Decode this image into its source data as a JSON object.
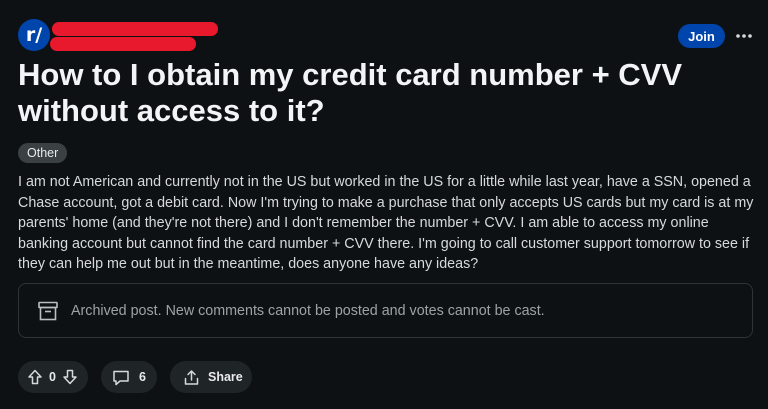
{
  "post": {
    "subreddit_avatar": "r/",
    "join_label": "Join",
    "more_label": "•••",
    "title": "How to I obtain my credit card number + CVV without access to it?",
    "flair": "Other",
    "body": "I am not American and currently not in the US but worked in the US for a little while last year, have a SSN, opened a Chase account, got a debit card. Now I'm trying to make a purchase that only accepts US cards but my card is at my parents' home (and they're not there) and I don't remember the number + CVV. I am able to access my online banking account but cannot find the card number + CVV there. I'm going to call customer support tomorrow to see if they can help me out but in the meantime, does anyone have any ideas?",
    "archived_notice": "Archived post. New comments cannot be posted and votes cannot be cast."
  },
  "actions": {
    "vote_count": "0",
    "comment_count": "6",
    "share_label": "Share"
  },
  "colors": {
    "background": "#0e1113",
    "accent": "#0045ac",
    "redaction": "#e8192c"
  },
  "icons": {
    "upvote": "arrow-up-icon",
    "downvote": "arrow-down-icon",
    "comment": "speech-bubble-icon",
    "share": "share-upload-icon",
    "archive": "archive-box-icon"
  }
}
